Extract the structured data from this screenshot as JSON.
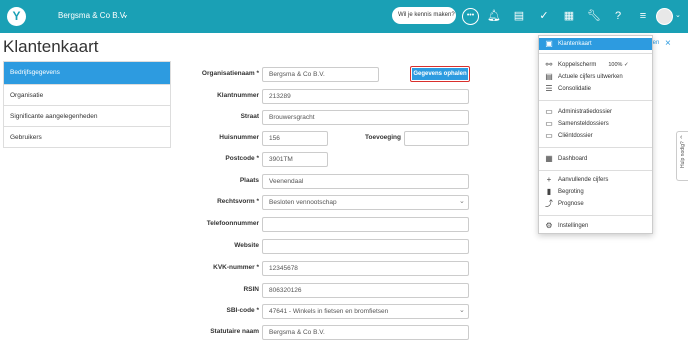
{
  "topbar": {
    "logo": "Y",
    "company": "Bergsma & Co B.V.",
    "company_chevron": "⌄",
    "help_placeholder": "Wil je kennis maken?",
    "icons": [
      "chat-icon",
      "bell-icon",
      "forms-icon",
      "check-circle-icon",
      "grid-icon",
      "wrench-icon",
      "help-icon",
      "menu-icon"
    ],
    "avatar_chevron": "⌄"
  },
  "page": {
    "title": "Klantenkaart",
    "back_label": "ten",
    "back_icon": "×"
  },
  "sidebar": {
    "items": [
      {
        "label": "Bedrijfsgegevens"
      },
      {
        "label": "Organisatie"
      },
      {
        "label": "Significante aangelegenheden"
      },
      {
        "label": "Gebruikers"
      }
    ]
  },
  "form": {
    "fetch_button": "Gegevens ophalen",
    "fields": {
      "organisatienaam": {
        "label": "Organisatienaam *",
        "value": "Bergsma & Co B.V."
      },
      "klantnummer": {
        "label": "Klantnummer",
        "value": "213289"
      },
      "straat": {
        "label": "Straat",
        "value": "Brouwersgracht"
      },
      "huisnummer": {
        "label": "Huisnummer",
        "value": "156"
      },
      "toevoeging": {
        "label": "Toevoeging",
        "value": ""
      },
      "postcode": {
        "label": "Postcode *",
        "value": "3901TM"
      },
      "plaats": {
        "label": "Plaats",
        "value": "Veenendaal"
      },
      "rechtsvorm": {
        "label": "Rechtsvorm *",
        "value": "Besloten vennootschap"
      },
      "telefoon": {
        "label": "Telefoonnummer",
        "value": ""
      },
      "website": {
        "label": "Website",
        "value": ""
      },
      "kvk": {
        "label": "KVK-nummer *",
        "value": "12345678"
      },
      "rsin": {
        "label": "RSIN",
        "value": "806320126"
      },
      "sbi": {
        "label": "SBI-code *",
        "value": "47641 - Winkels in fietsen en bromfietsen"
      },
      "statutaire": {
        "label": "Statutaire naam",
        "value": "Bergsma & Co B.V."
      }
    }
  },
  "dropdown": {
    "items": [
      {
        "label": "Klantenkaart",
        "icon": "id-card-icon",
        "glyph": "▣",
        "active": true
      },
      {
        "label": "Koppelscherm",
        "icon": "link-icon",
        "glyph": "⚯",
        "extra": "100% ✓"
      },
      {
        "label": "Actuele cijfers uitwerken",
        "icon": "doc-icon",
        "glyph": "▤"
      },
      {
        "label": "Consolidatie",
        "icon": "layers-icon",
        "glyph": "☰"
      },
      {
        "label": "Administratiedossier",
        "icon": "folder-icon",
        "glyph": "▭"
      },
      {
        "label": "Samensteldossiers",
        "icon": "folders-icon",
        "glyph": "▭"
      },
      {
        "label": "Cliëntdossier",
        "icon": "folder-user-icon",
        "glyph": "▭"
      },
      {
        "label": "Dashboard",
        "icon": "dashboard-icon",
        "glyph": "▦"
      },
      {
        "label": "Aanvullende cijfers",
        "icon": "plus-icon",
        "glyph": "+"
      },
      {
        "label": "Begroting",
        "icon": "bar-chart-icon",
        "glyph": "▮"
      },
      {
        "label": "Prognose",
        "icon": "trend-icon",
        "glyph": "⤴"
      },
      {
        "label": "Instellingen",
        "icon": "gear-icon",
        "glyph": "⚙"
      }
    ]
  },
  "hulp": {
    "label": "Hulp nodig?",
    "chevron": "‹"
  }
}
